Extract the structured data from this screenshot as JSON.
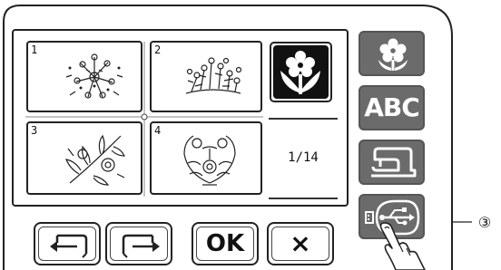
{
  "screen": {
    "patterns": [
      {
        "number": "1"
      },
      {
        "number": "2"
      },
      {
        "number": "3"
      },
      {
        "number": "4"
      }
    ],
    "page_indicator": "1/14"
  },
  "side_buttons": {
    "floral_icon": "floral-category-icon",
    "abc_label": "ABC",
    "sewing_icon": "sewing-machine-icon",
    "usb_icon": "usb-icon"
  },
  "bottom_buttons": {
    "ok_label": "OK",
    "cancel_label": "×"
  },
  "callout": {
    "label": "③"
  },
  "colors": {
    "side_button_gray": "#6b6b6b",
    "outline": "#222222"
  }
}
